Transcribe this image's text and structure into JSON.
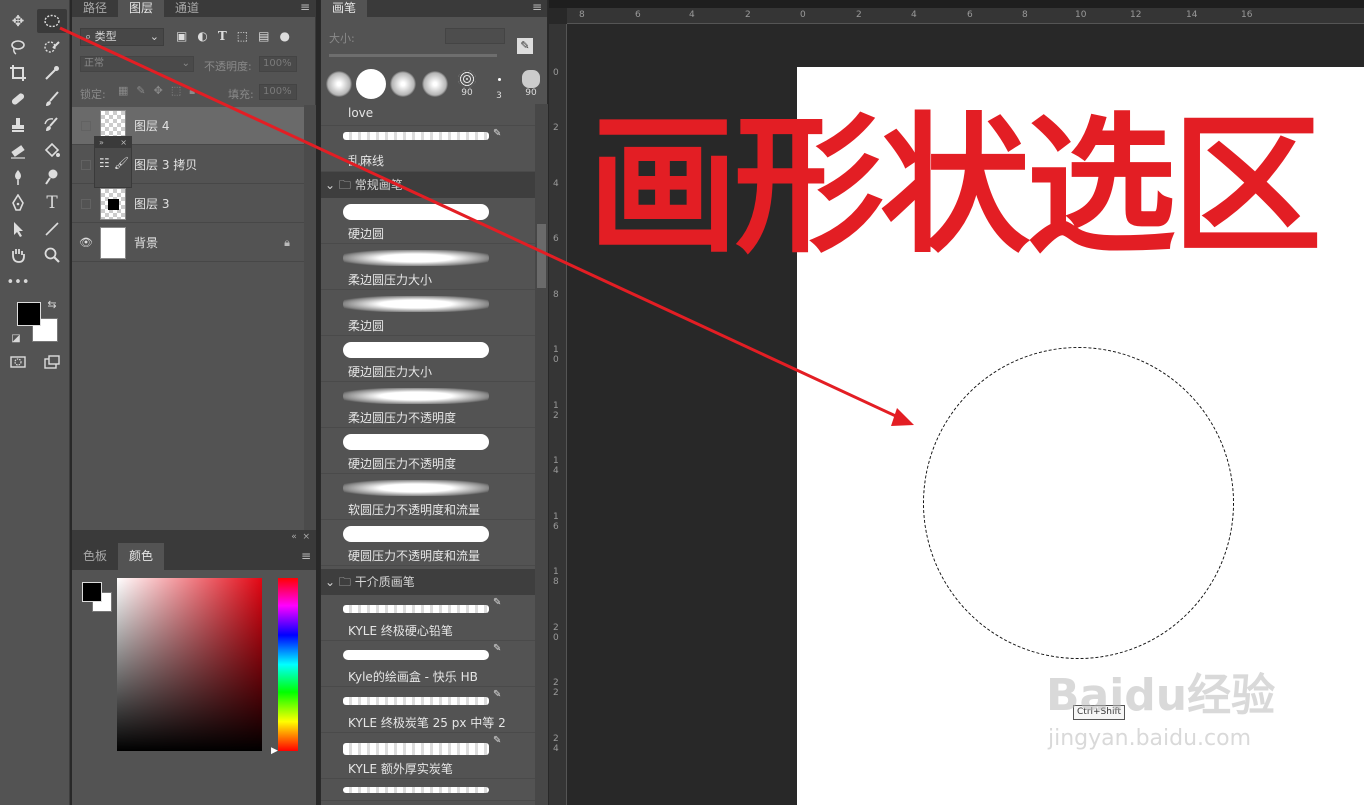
{
  "tabs_left": [
    "路径",
    "图层",
    "通道"
  ],
  "layers_panel": {
    "filter_kind": "类型",
    "blend_mode": "正常",
    "opacity_label": "不透明度:",
    "opacity_value": "100%",
    "lock_label": "锁定:",
    "fill_label": "填充:",
    "fill_value": "100%",
    "layers": [
      {
        "name": "图层 4",
        "selected": true,
        "visible": false
      },
      {
        "name": "图层 3 拷贝",
        "selected": false,
        "visible": false
      },
      {
        "name": "图层 3",
        "selected": false,
        "visible": false
      },
      {
        "name": "背景",
        "selected": false,
        "visible": true,
        "locked": true
      }
    ]
  },
  "color_panel": {
    "tabs": [
      "色板",
      "颜色"
    ],
    "fg_color": "#000000",
    "bg_color": "#ffffff"
  },
  "brush_panel": {
    "tab": "画笔",
    "size_label": "大小:",
    "presets": [
      {
        "label": ""
      },
      {
        "label": ""
      },
      {
        "label": ""
      },
      {
        "label": ""
      },
      {
        "label": "90"
      },
      {
        "label": "3"
      },
      {
        "label": "90"
      }
    ],
    "top_items": [
      {
        "label": "love"
      },
      {
        "label": "乱麻线"
      }
    ],
    "groups": [
      {
        "name": "常规画笔",
        "items": [
          "硬边圆",
          "柔边圆压力大小",
          "柔边圆",
          "硬边圆压力大小",
          "柔边圆压力不透明度",
          "硬边圆压力不透明度",
          "软圆压力不透明度和流量",
          "硬圆压力不透明度和流量"
        ]
      },
      {
        "name": "干介质画笔",
        "items": [
          "KYLE 终极硬心铅笔",
          "Kyle的绘画盒 - 快乐 HB",
          "KYLE 终极炭笔 25 px 中等 2",
          "KYLE 额外厚实炭笔"
        ]
      }
    ]
  },
  "rulers": {
    "horizontal": [
      "8",
      "6",
      "4",
      "2",
      "0",
      "2",
      "4",
      "6",
      "8",
      "10",
      "12",
      "14",
      "16"
    ],
    "vertical": [
      "0",
      "2",
      "4",
      "6",
      "8",
      "1 0",
      "1 2",
      "1 4",
      "1 6",
      "1 8",
      "2 0",
      "2 2",
      "2 4"
    ]
  },
  "canvas": {
    "title_text": "画形状选区",
    "title_color": "#e31e24",
    "tooltip": "Ctrl+Shift",
    "watermark_brand": "Baidu经验",
    "watermark_url": "jingyan.baidu.com"
  }
}
